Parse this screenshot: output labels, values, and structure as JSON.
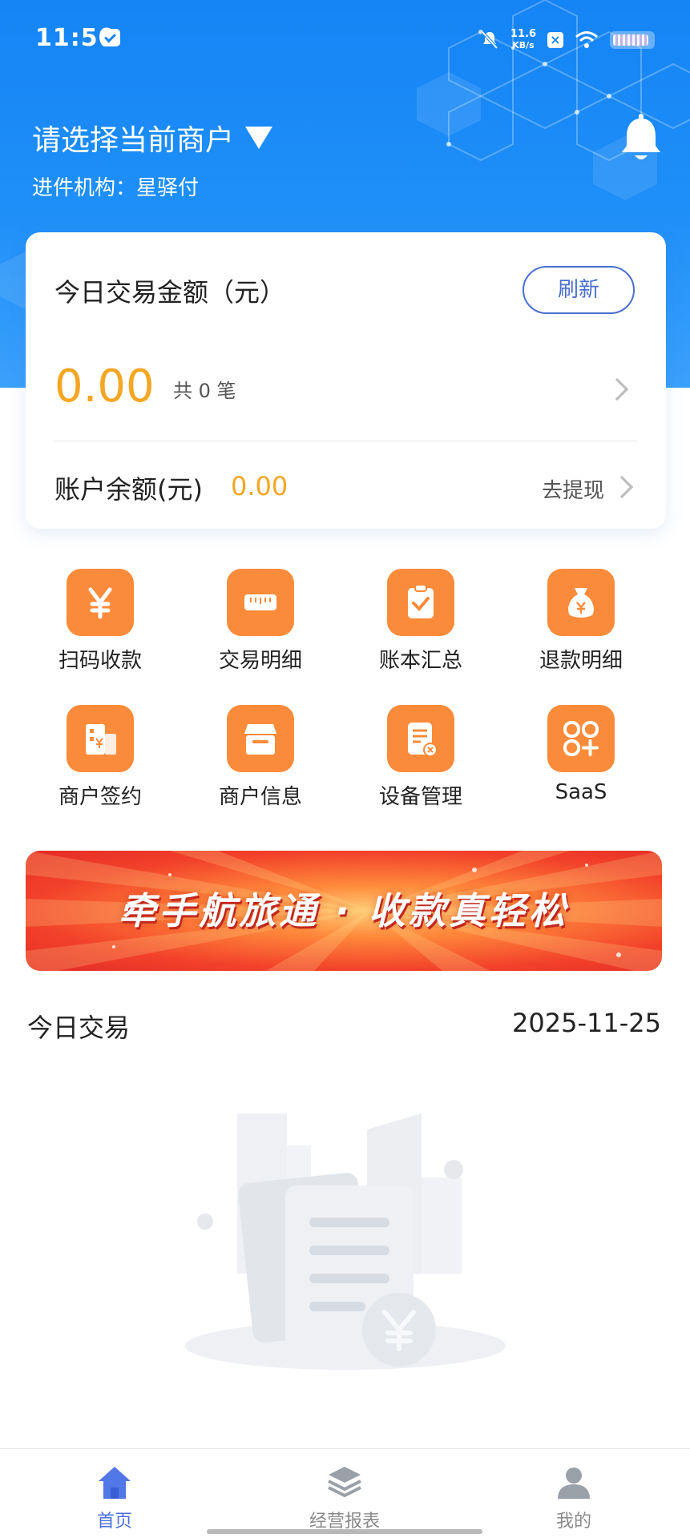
{
  "status_bar": {
    "time": "11:50",
    "speed_value": "11.6",
    "speed_unit": "KB/s"
  },
  "header": {
    "merchant_select": "请选择当前商户",
    "org_label": "进件机构：",
    "org_value": "星驿付"
  },
  "card": {
    "title": "今日交易金额（元）",
    "refresh_label": "刷新",
    "amount": "0.00",
    "count": "共 0 笔",
    "balance_label": "账户余额(元)",
    "balance_value": "0.00",
    "withdraw_label": "去提现"
  },
  "grid": {
    "items": [
      {
        "label": "扫码收款",
        "icon": "yen-icon"
      },
      {
        "label": "交易明细",
        "icon": "ruler-icon"
      },
      {
        "label": "账本汇总",
        "icon": "clipboard-check-icon"
      },
      {
        "label": "退款明细",
        "icon": "money-bag-icon"
      },
      {
        "label": "商户签约",
        "icon": "building-yen-icon"
      },
      {
        "label": "商户信息",
        "icon": "store-icon"
      },
      {
        "label": "设备管理",
        "icon": "document-x-icon"
      },
      {
        "label": "SaaS",
        "icon": "apps-plus-icon"
      }
    ]
  },
  "banner": {
    "text": "牵手航旅通 · 收款真轻松"
  },
  "today": {
    "label": "今日交易",
    "date": "2025-11-25"
  },
  "bottom_nav": {
    "items": [
      {
        "label": "首页",
        "icon": "home-icon",
        "active": true
      },
      {
        "label": "经营报表",
        "icon": "layers-icon",
        "active": false
      },
      {
        "label": "我的",
        "icon": "user-icon",
        "active": false
      }
    ]
  },
  "colors": {
    "header_blue": "#1584f5",
    "accent_orange": "#fa8b3a",
    "amount_orange": "#f5a623",
    "refresh_blue": "#4a6fd0",
    "nav_active": "#4a6fe0"
  }
}
